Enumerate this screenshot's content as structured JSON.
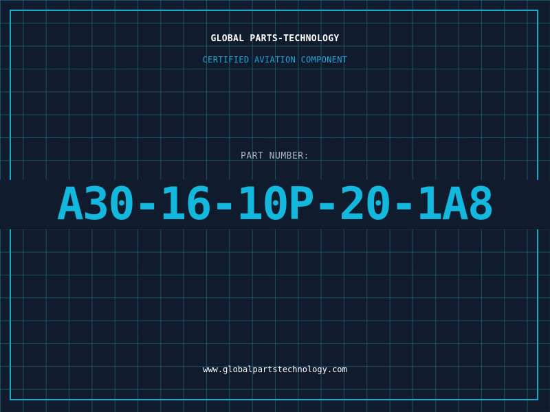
{
  "header": {
    "title": "GLOBAL PARTS-TECHNOLOGY",
    "subtitle": "CERTIFIED AVIATION COMPONENT"
  },
  "part": {
    "label": "PART NUMBER:",
    "number": "A30-16-10P-20-1A8"
  },
  "footer": {
    "url": "www.globalpartstechnology.com"
  },
  "colors": {
    "background": "#111b2e",
    "grid": "#237d96",
    "frame": "#1aa8cc",
    "accent": "#12b8dd",
    "title": "#ffffff",
    "label": "#a8b4c4"
  }
}
